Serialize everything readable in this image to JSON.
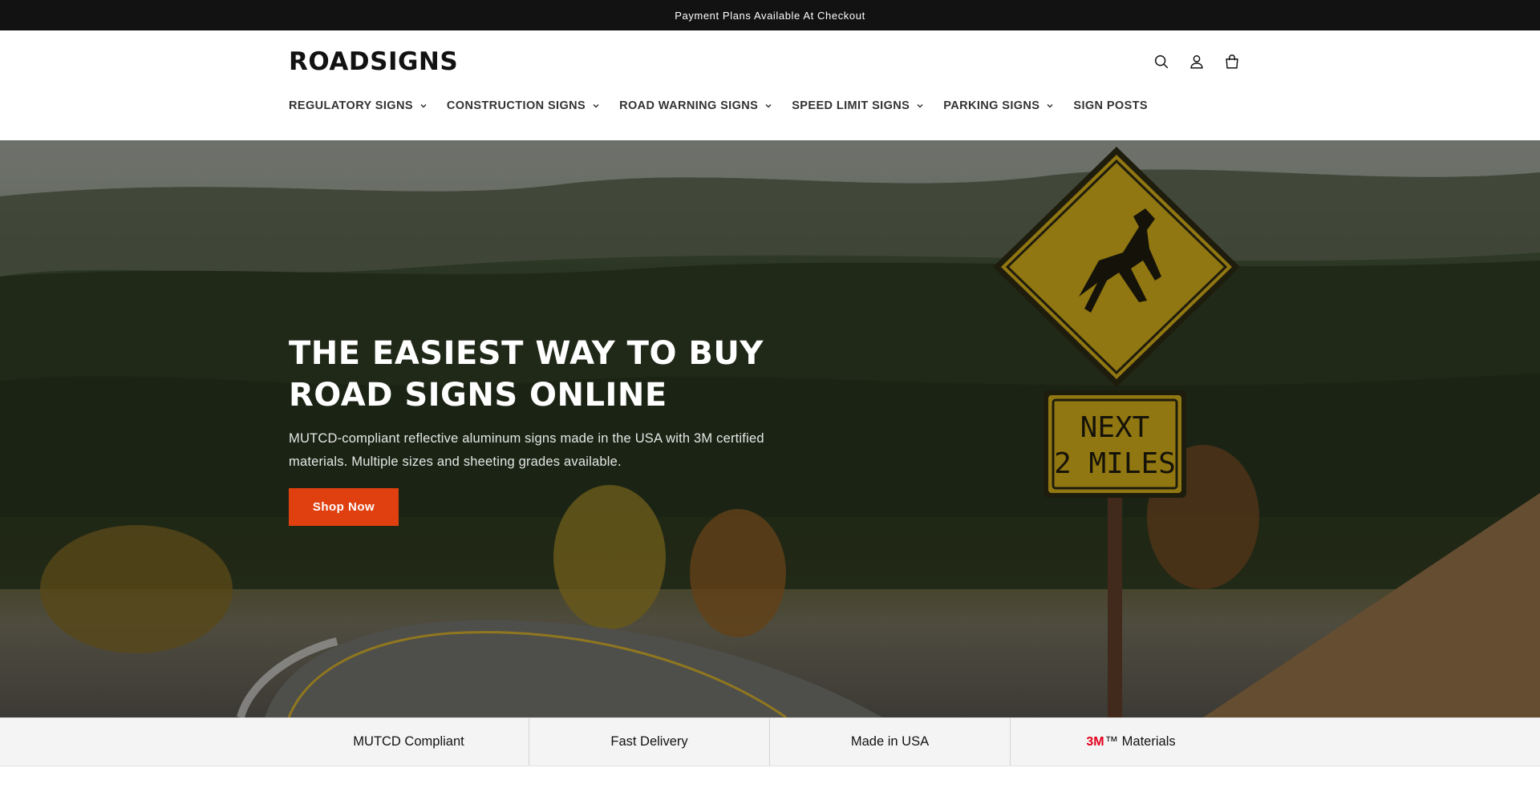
{
  "announcement": {
    "text": "Payment Plans Available At Checkout"
  },
  "header": {
    "logo": "ROADSIGNS",
    "icons": [
      "search-icon",
      "account-icon",
      "cart-icon"
    ]
  },
  "nav": {
    "items": [
      {
        "label": "REGULATORY SIGNS",
        "has_dropdown": true
      },
      {
        "label": "CONSTRUCTION SIGNS",
        "has_dropdown": true
      },
      {
        "label": "ROAD WARNING SIGNS",
        "has_dropdown": true
      },
      {
        "label": "SPEED LIMIT SIGNS",
        "has_dropdown": true
      },
      {
        "label": "PARKING SIGNS",
        "has_dropdown": true
      },
      {
        "label": "SIGN POSTS",
        "has_dropdown": false
      }
    ]
  },
  "hero": {
    "title": "THE EASIEST WAY TO BUY ROAD SIGNS ONLINE",
    "subtitle": "MUTCD-compliant reflective aluminum signs made in the USA with 3M certified materials. Multiple sizes and sheeting grades available.",
    "cta_label": "Shop Now",
    "image_sign_text": [
      "NEXT",
      "2 MILES"
    ]
  },
  "features": {
    "items": [
      "MUTCD Compliant",
      "Fast Delivery",
      "Made in USA"
    ],
    "materials_brand": "3M",
    "materials_label": "™ Materials"
  },
  "colors": {
    "accent": "#e0400f",
    "announcement_bg": "#121212",
    "sign_yellow": "#c9a518",
    "brand_3m": "#e2001a"
  }
}
